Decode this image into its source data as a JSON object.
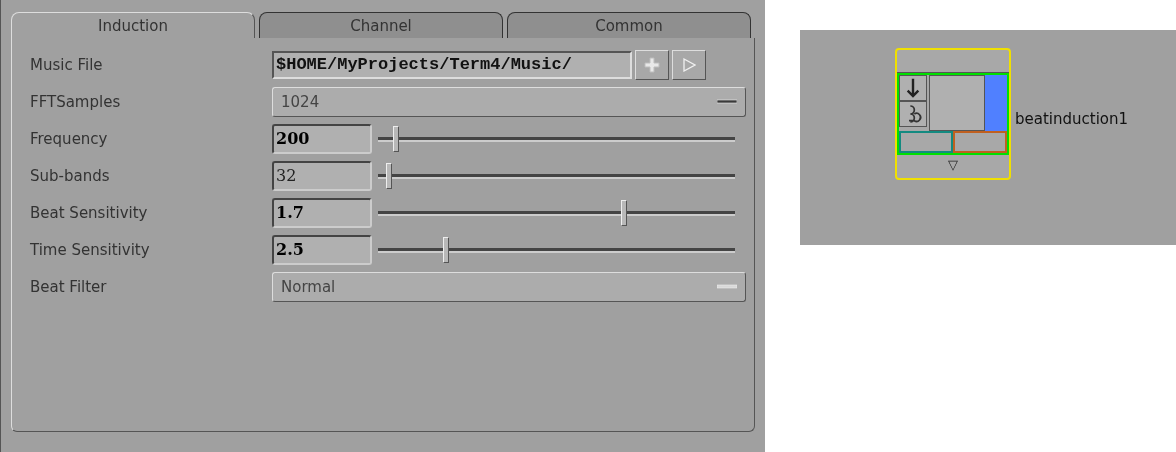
{
  "tabs": [
    {
      "label": "Induction",
      "selected": true
    },
    {
      "label": "Channel",
      "selected": false
    },
    {
      "label": "Common",
      "selected": false
    }
  ],
  "params": [
    {
      "kind": "file",
      "label": "Music File",
      "value": "$HOME/MyProjects/Term4/Music/"
    },
    {
      "kind": "menu",
      "label": "FFTSamples",
      "value": "1024",
      "disabled": false
    },
    {
      "kind": "slider",
      "label": "Frequency",
      "value": "200",
      "bold": true,
      "level": 0.05
    },
    {
      "kind": "slider",
      "label": "Sub-bands",
      "value": "32",
      "bold": false,
      "level": 0.03
    },
    {
      "kind": "slider",
      "label": "Beat Sensitivity",
      "value": "1.7",
      "bold": true,
      "level": 0.69
    },
    {
      "kind": "slider",
      "label": "Time Sensitivity",
      "value": "2.5",
      "bold": true,
      "level": 0.19
    },
    {
      "kind": "menu",
      "label": "Beat Filter",
      "value": "Normal",
      "disabled": true
    }
  ],
  "node": {
    "name": "beatinduction1",
    "expand_glyph": "▽"
  }
}
